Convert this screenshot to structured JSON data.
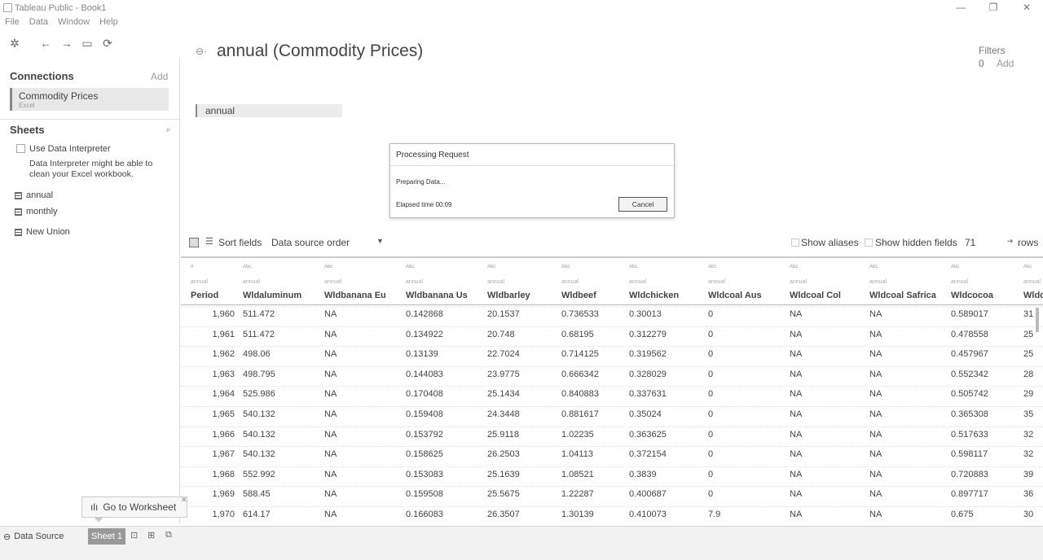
{
  "window": {
    "title": "Tableau Public - Book1",
    "min": "—",
    "max": "❐",
    "close": "✕"
  },
  "menu": [
    "File",
    "Data",
    "Window",
    "Help"
  ],
  "toolbar": {
    "logo": "✲",
    "back": "←",
    "forward": "→",
    "save": "▭",
    "refresh": "⟳"
  },
  "connections": {
    "heading": "Connections",
    "add": "Add",
    "item": {
      "name": "Commodity Prices",
      "type": "Excel"
    }
  },
  "sheets": {
    "heading": "Sheets",
    "search": "⌕",
    "interpreter_label": "Use Data Interpreter",
    "interpreter_note": "Data Interpreter might be able to clean your Excel workbook.",
    "items": [
      "annual",
      "monthly"
    ],
    "new_union": "New Union"
  },
  "datasource": {
    "icon": "⊖·",
    "title": "annual (Commodity Prices)",
    "filters_label": "Filters",
    "filters_count": "0",
    "filters_add": "Add",
    "table": "annual"
  },
  "dialog": {
    "title": "Processing Request",
    "message": "Preparing Data...",
    "elapsed": "Elapsed time 00:09",
    "cancel": "Cancel"
  },
  "gridbar": {
    "list_icon": "☰",
    "sort_label": "Sort fields",
    "sort_value": "Data source order",
    "sort_caret": "▼",
    "show_aliases": "Show aliases",
    "show_hidden": "Show hidden fields",
    "rows_count": "71",
    "rows_arrow": "➔",
    "rows_label": "rows"
  },
  "grid": {
    "columns": [
      {
        "type": "#",
        "source": "annual",
        "name": "Period"
      },
      {
        "type": "Abc",
        "source": "annual",
        "name": "Wldaluminum"
      },
      {
        "type": "Abc",
        "source": "annual",
        "name": "Wldbanana Eu"
      },
      {
        "type": "Abc",
        "source": "annual",
        "name": "Wldbanana Us"
      },
      {
        "type": "Abc",
        "source": "annual",
        "name": "Wldbarley"
      },
      {
        "type": "Abc",
        "source": "annual",
        "name": "Wldbeef"
      },
      {
        "type": "Abc",
        "source": "annual",
        "name": "Wldchicken"
      },
      {
        "type": "Abc",
        "source": "annual",
        "name": "Wldcoal Aus"
      },
      {
        "type": "Abc",
        "source": "annual",
        "name": "Wldcoal Col"
      },
      {
        "type": "Abc",
        "source": "annual",
        "name": "Wldcoal Safrica"
      },
      {
        "type": "Abc",
        "source": "annual",
        "name": "Wldcocoa"
      },
      {
        "type": "Abc",
        "source": "annual",
        "name": "Wldc"
      }
    ],
    "rows": [
      [
        "1,960",
        "511.472",
        "NA",
        "0.142868",
        "20.1537",
        "0.736533",
        "0.30013",
        "0",
        "NA",
        "NA",
        "0.589017",
        "31"
      ],
      [
        "1,961",
        "511.472",
        "NA",
        "0.134922",
        "20.748",
        "0.68195",
        "0.312279",
        "0",
        "NA",
        "NA",
        "0.478558",
        "25"
      ],
      [
        "1,962",
        "498.06",
        "NA",
        "0.13139",
        "22.7024",
        "0.714125",
        "0.319562",
        "0",
        "NA",
        "NA",
        "0.457967",
        "25"
      ],
      [
        "1,963",
        "498.795",
        "NA",
        "0.144083",
        "23.9775",
        "0.666342",
        "0.328029",
        "0",
        "NA",
        "NA",
        "0.552342",
        "28"
      ],
      [
        "1,964",
        "525.986",
        "NA",
        "0.170408",
        "25.1434",
        "0.840883",
        "0.337631",
        "0",
        "NA",
        "NA",
        "0.505742",
        "29"
      ],
      [
        "1,965",
        "540.132",
        "NA",
        "0.159408",
        "24.3448",
        "0.881617",
        "0.35024",
        "0",
        "NA",
        "NA",
        "0.365308",
        "35"
      ],
      [
        "1,966",
        "540.132",
        "NA",
        "0.153792",
        "25.9118",
        "1.02235",
        "0.363625",
        "0",
        "NA",
        "NA",
        "0.517633",
        "32"
      ],
      [
        "1,967",
        "540.132",
        "NA",
        "0.158625",
        "26.2503",
        "1.04113",
        "0.372154",
        "0",
        "NA",
        "NA",
        "0.598117",
        "32"
      ],
      [
        "1,968",
        "552.992",
        "NA",
        "0.153083",
        "25.1639",
        "1.08521",
        "0.3839",
        "0",
        "NA",
        "NA",
        "0.720883",
        "39"
      ],
      [
        "1,969",
        "588.45",
        "NA",
        "0.159508",
        "25.5675",
        "1.22287",
        "0.400687",
        "0",
        "NA",
        "NA",
        "0.897717",
        "36"
      ],
      [
        "1,970",
        "614.17",
        "NA",
        "0.166083",
        "26.3507",
        "1.30139",
        "0.410073",
        "7.9",
        "NA",
        "NA",
        "0.675",
        "30"
      ]
    ]
  },
  "tooltip": {
    "icon": "ılı",
    "label": "Go to Worksheet",
    "close": "✕"
  },
  "tabs": {
    "datasource_icon": "⊖",
    "datasource": "Data Source",
    "sheet": "Sheet 1",
    "new_sheet": "⊡",
    "new_dashboard": "⊞",
    "new_story": "⧉"
  }
}
